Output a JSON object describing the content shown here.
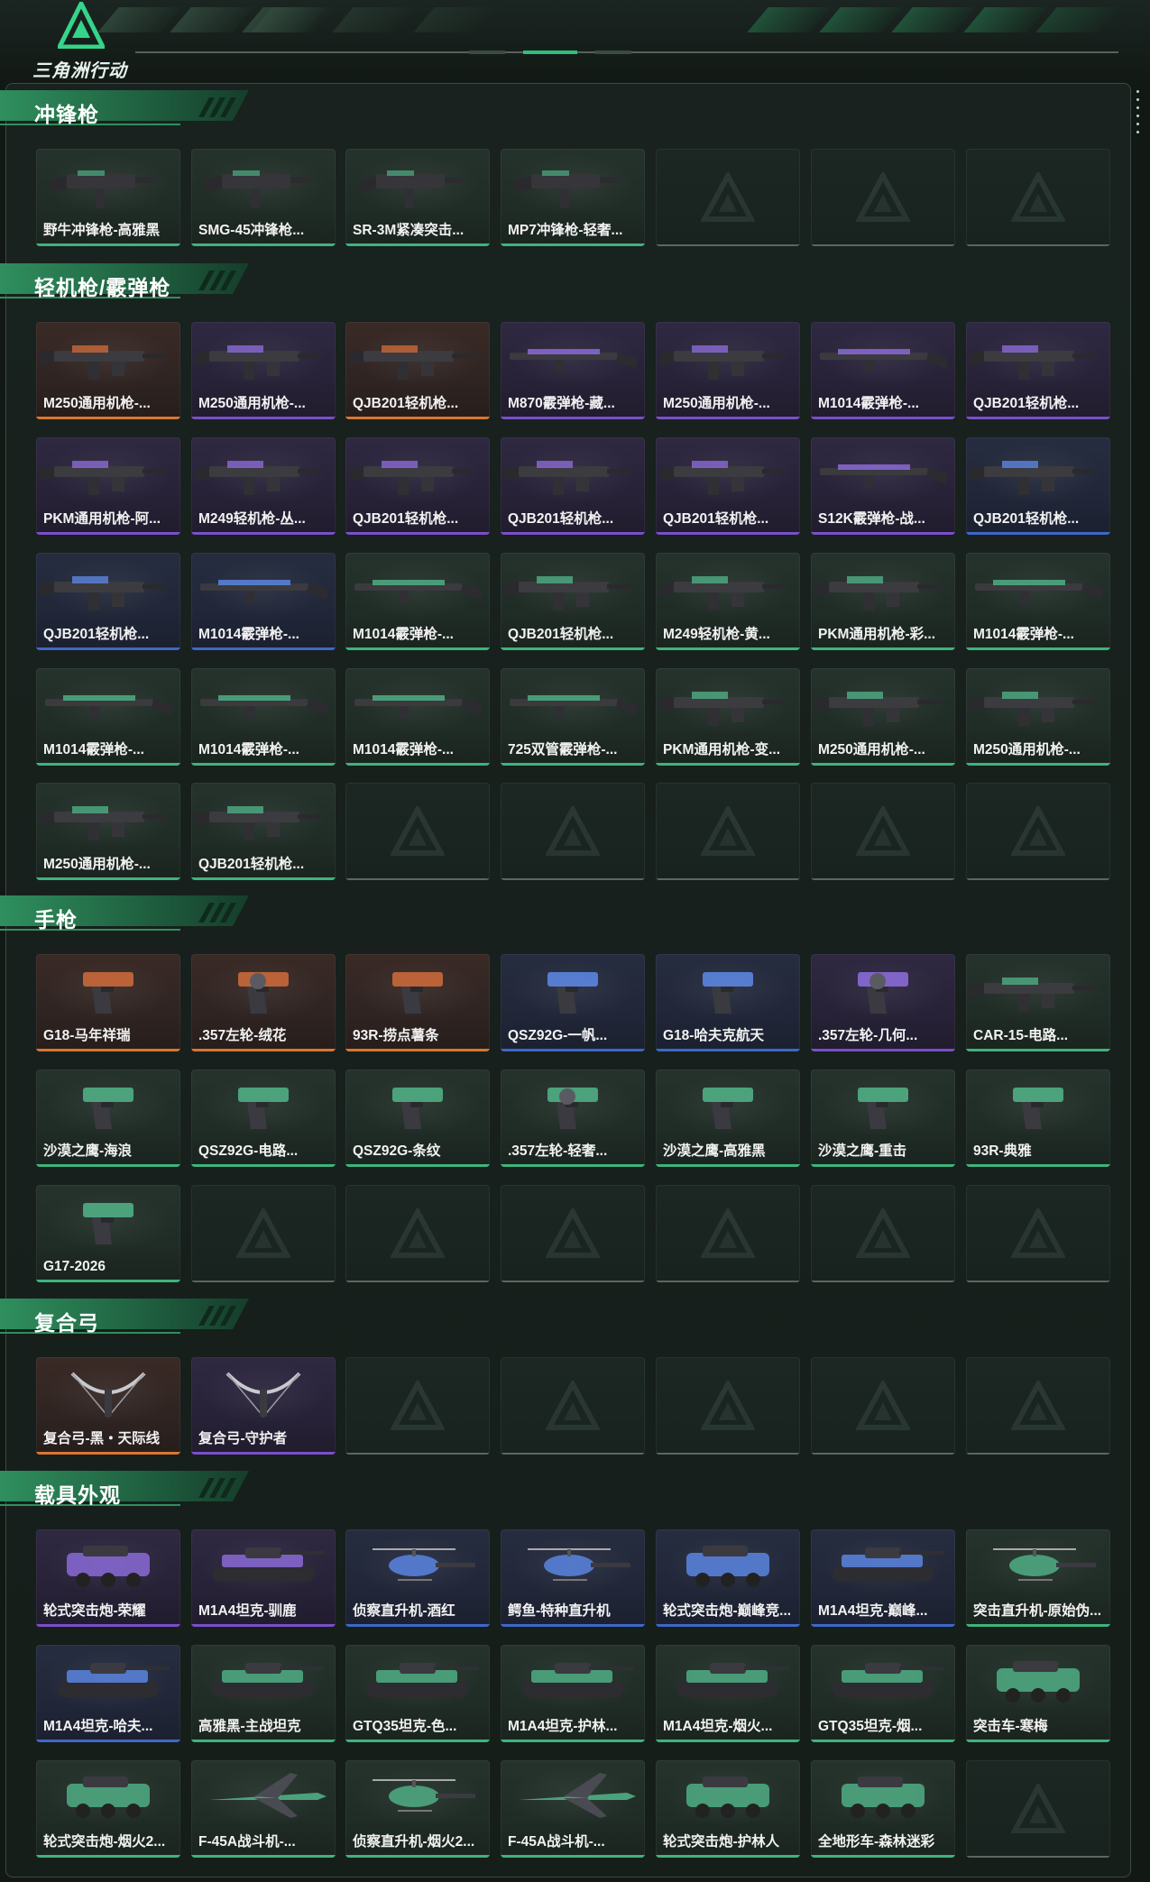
{
  "app": {
    "logo_text": "三角洲行动"
  },
  "colors": {
    "orange": "#d9772f",
    "purple": "#7a4fc9",
    "blue": "#3e68c9",
    "green": "#3fb37d",
    "empty": "#5c6761"
  },
  "sections": [
    {
      "title": "冲锋枪",
      "rows": [
        [
          {
            "name": "野牛冲锋枪-高雅黑",
            "rarity": "green",
            "icon": "smg-icon"
          },
          {
            "name": "SMG-45冲锋枪...",
            "rarity": "green",
            "icon": "smg-icon"
          },
          {
            "name": "SR-3M紧凑突击...",
            "rarity": "green",
            "icon": "smg-icon"
          },
          {
            "name": "MP7冲锋枪-轻奢...",
            "rarity": "green",
            "icon": "smg-icon"
          },
          null,
          null,
          null
        ]
      ]
    },
    {
      "title": "轻机枪/霰弹枪",
      "rows": [
        [
          {
            "name": "M250通用机枪-...",
            "rarity": "orange",
            "icon": "machine-gun-icon"
          },
          {
            "name": "M250通用机枪-...",
            "rarity": "purple",
            "icon": "machine-gun-icon"
          },
          {
            "name": "QJB201轻机枪...",
            "rarity": "orange",
            "icon": "machine-gun-icon"
          },
          {
            "name": "M870霰弹枪-藏...",
            "rarity": "purple",
            "icon": "shotgun-icon"
          },
          {
            "name": "M250通用机枪-...",
            "rarity": "purple",
            "icon": "machine-gun-icon"
          },
          {
            "name": "M1014霰弹枪-...",
            "rarity": "purple",
            "icon": "shotgun-icon"
          },
          {
            "name": "QJB201轻机枪...",
            "rarity": "purple",
            "icon": "machine-gun-icon"
          }
        ],
        [
          {
            "name": "PKM通用机枪-阿...",
            "rarity": "purple",
            "icon": "machine-gun-icon"
          },
          {
            "name": "M249轻机枪-丛...",
            "rarity": "purple",
            "icon": "machine-gun-icon"
          },
          {
            "name": "QJB201轻机枪...",
            "rarity": "purple",
            "icon": "machine-gun-icon"
          },
          {
            "name": "QJB201轻机枪...",
            "rarity": "purple",
            "icon": "machine-gun-icon"
          },
          {
            "name": "QJB201轻机枪...",
            "rarity": "purple",
            "icon": "machine-gun-icon"
          },
          {
            "name": "S12K霰弹枪-战...",
            "rarity": "purple",
            "icon": "shotgun-icon"
          },
          {
            "name": "QJB201轻机枪...",
            "rarity": "blue",
            "icon": "machine-gun-icon"
          }
        ],
        [
          {
            "name": "QJB201轻机枪...",
            "rarity": "blue",
            "icon": "machine-gun-icon"
          },
          {
            "name": "M1014霰弹枪-...",
            "rarity": "blue",
            "icon": "shotgun-icon"
          },
          {
            "name": "M1014霰弹枪-...",
            "rarity": "green",
            "icon": "shotgun-icon"
          },
          {
            "name": "QJB201轻机枪...",
            "rarity": "green",
            "icon": "machine-gun-icon"
          },
          {
            "name": "M249轻机枪-黄...",
            "rarity": "green",
            "icon": "machine-gun-icon"
          },
          {
            "name": "PKM通用机枪-彩...",
            "rarity": "green",
            "icon": "machine-gun-icon"
          },
          {
            "name": "M1014霰弹枪-...",
            "rarity": "green",
            "icon": "shotgun-icon"
          }
        ],
        [
          {
            "name": "M1014霰弹枪-...",
            "rarity": "green",
            "icon": "shotgun-icon"
          },
          {
            "name": "M1014霰弹枪-...",
            "rarity": "green",
            "icon": "shotgun-icon"
          },
          {
            "name": "M1014霰弹枪-...",
            "rarity": "green",
            "icon": "shotgun-icon"
          },
          {
            "name": "725双管霰弹枪-...",
            "rarity": "green",
            "icon": "shotgun-icon"
          },
          {
            "name": "PKM通用机枪-变...",
            "rarity": "green",
            "icon": "machine-gun-icon"
          },
          {
            "name": "M250通用机枪-...",
            "rarity": "green",
            "icon": "machine-gun-icon"
          },
          {
            "name": "M250通用机枪-...",
            "rarity": "green",
            "icon": "machine-gun-icon"
          }
        ],
        [
          {
            "name": "M250通用机枪-...",
            "rarity": "green",
            "icon": "machine-gun-icon"
          },
          {
            "name": "QJB201轻机枪...",
            "rarity": "green",
            "icon": "machine-gun-icon"
          },
          null,
          null,
          null,
          null,
          null
        ]
      ]
    },
    {
      "title": "手枪",
      "rows": [
        [
          {
            "name": "G18-马年祥瑞",
            "rarity": "orange",
            "icon": "pistol-icon"
          },
          {
            "name": ".357左轮-绒花",
            "rarity": "orange",
            "icon": "revolver-icon"
          },
          {
            "name": "93R-捞点薯条",
            "rarity": "orange",
            "icon": "pistol-icon"
          },
          {
            "name": "QSZ92G-一帆...",
            "rarity": "blue",
            "icon": "pistol-icon"
          },
          {
            "name": "G18-哈夫克航天",
            "rarity": "blue",
            "icon": "pistol-icon"
          },
          {
            "name": ".357左轮-几何...",
            "rarity": "purple",
            "icon": "revolver-icon"
          },
          {
            "name": "CAR-15-电路...",
            "rarity": "green",
            "icon": "rifle-icon"
          }
        ],
        [
          {
            "name": "沙漠之鹰-海浪",
            "rarity": "green",
            "icon": "pistol-icon"
          },
          {
            "name": "QSZ92G-电路...",
            "rarity": "green",
            "icon": "pistol-icon"
          },
          {
            "name": "QSZ92G-条纹",
            "rarity": "green",
            "icon": "pistol-icon"
          },
          {
            "name": ".357左轮-轻奢...",
            "rarity": "green",
            "icon": "revolver-icon"
          },
          {
            "name": "沙漠之鹰-高雅黑",
            "rarity": "green",
            "icon": "pistol-icon"
          },
          {
            "name": "沙漠之鹰-重击",
            "rarity": "green",
            "icon": "pistol-icon"
          },
          {
            "name": "93R-典雅",
            "rarity": "green",
            "icon": "pistol-icon"
          }
        ],
        [
          {
            "name": "G17-2026",
            "rarity": "green",
            "icon": "pistol-icon"
          },
          null,
          null,
          null,
          null,
          null,
          null
        ]
      ]
    },
    {
      "title": "复合弓",
      "rows": [
        [
          {
            "name": "复合弓-黑・天际线",
            "rarity": "orange",
            "icon": "bow-icon"
          },
          {
            "name": "复合弓-守护者",
            "rarity": "purple",
            "icon": "bow-icon"
          },
          null,
          null,
          null,
          null,
          null
        ]
      ]
    },
    {
      "title": "载具外观",
      "rows": [
        [
          {
            "name": "轮式突击炮-荣耀",
            "rarity": "purple",
            "icon": "armored-car-icon"
          },
          {
            "name": "M1A4坦克-驯鹿",
            "rarity": "purple",
            "icon": "tank-icon"
          },
          {
            "name": "侦察直升机-酒红",
            "rarity": "blue",
            "icon": "helicopter-icon"
          },
          {
            "name": "鳄鱼-特种直升机",
            "rarity": "blue",
            "icon": "helicopter-icon"
          },
          {
            "name": "轮式突击炮-巅峰竞...",
            "rarity": "blue",
            "icon": "armored-car-icon"
          },
          {
            "name": "M1A4坦克-巅峰...",
            "rarity": "blue",
            "icon": "tank-icon"
          },
          {
            "name": "突击直升机-原始伪...",
            "rarity": "green",
            "icon": "helicopter-icon"
          }
        ],
        [
          {
            "name": "M1A4坦克-哈夫...",
            "rarity": "blue",
            "icon": "tank-icon"
          },
          {
            "name": "高雅黑-主战坦克",
            "rarity": "green",
            "icon": "tank-icon"
          },
          {
            "name": "GTQ35坦克-色...",
            "rarity": "green",
            "icon": "tank-icon"
          },
          {
            "name": "M1A4坦克-护林...",
            "rarity": "green",
            "icon": "tank-icon"
          },
          {
            "name": "M1A4坦克-烟火...",
            "rarity": "green",
            "icon": "tank-icon"
          },
          {
            "name": "GTQ35坦克-烟...",
            "rarity": "green",
            "icon": "tank-icon"
          },
          {
            "name": "突击车-寒梅",
            "rarity": "green",
            "icon": "armored-car-icon"
          }
        ],
        [
          {
            "name": "轮式突击炮-烟火2...",
            "rarity": "green",
            "icon": "armored-car-icon"
          },
          {
            "name": "F-45A战斗机-...",
            "rarity": "green",
            "icon": "jet-icon"
          },
          {
            "name": "侦察直升机-烟火2...",
            "rarity": "green",
            "icon": "helicopter-icon"
          },
          {
            "name": "F-45A战斗机-...",
            "rarity": "green",
            "icon": "jet-icon"
          },
          {
            "name": "轮式突击炮-护林人",
            "rarity": "green",
            "icon": "armored-car-icon"
          },
          {
            "name": "全地形车-森林迷彩",
            "rarity": "green",
            "icon": "atv-icon"
          },
          null
        ]
      ]
    }
  ]
}
